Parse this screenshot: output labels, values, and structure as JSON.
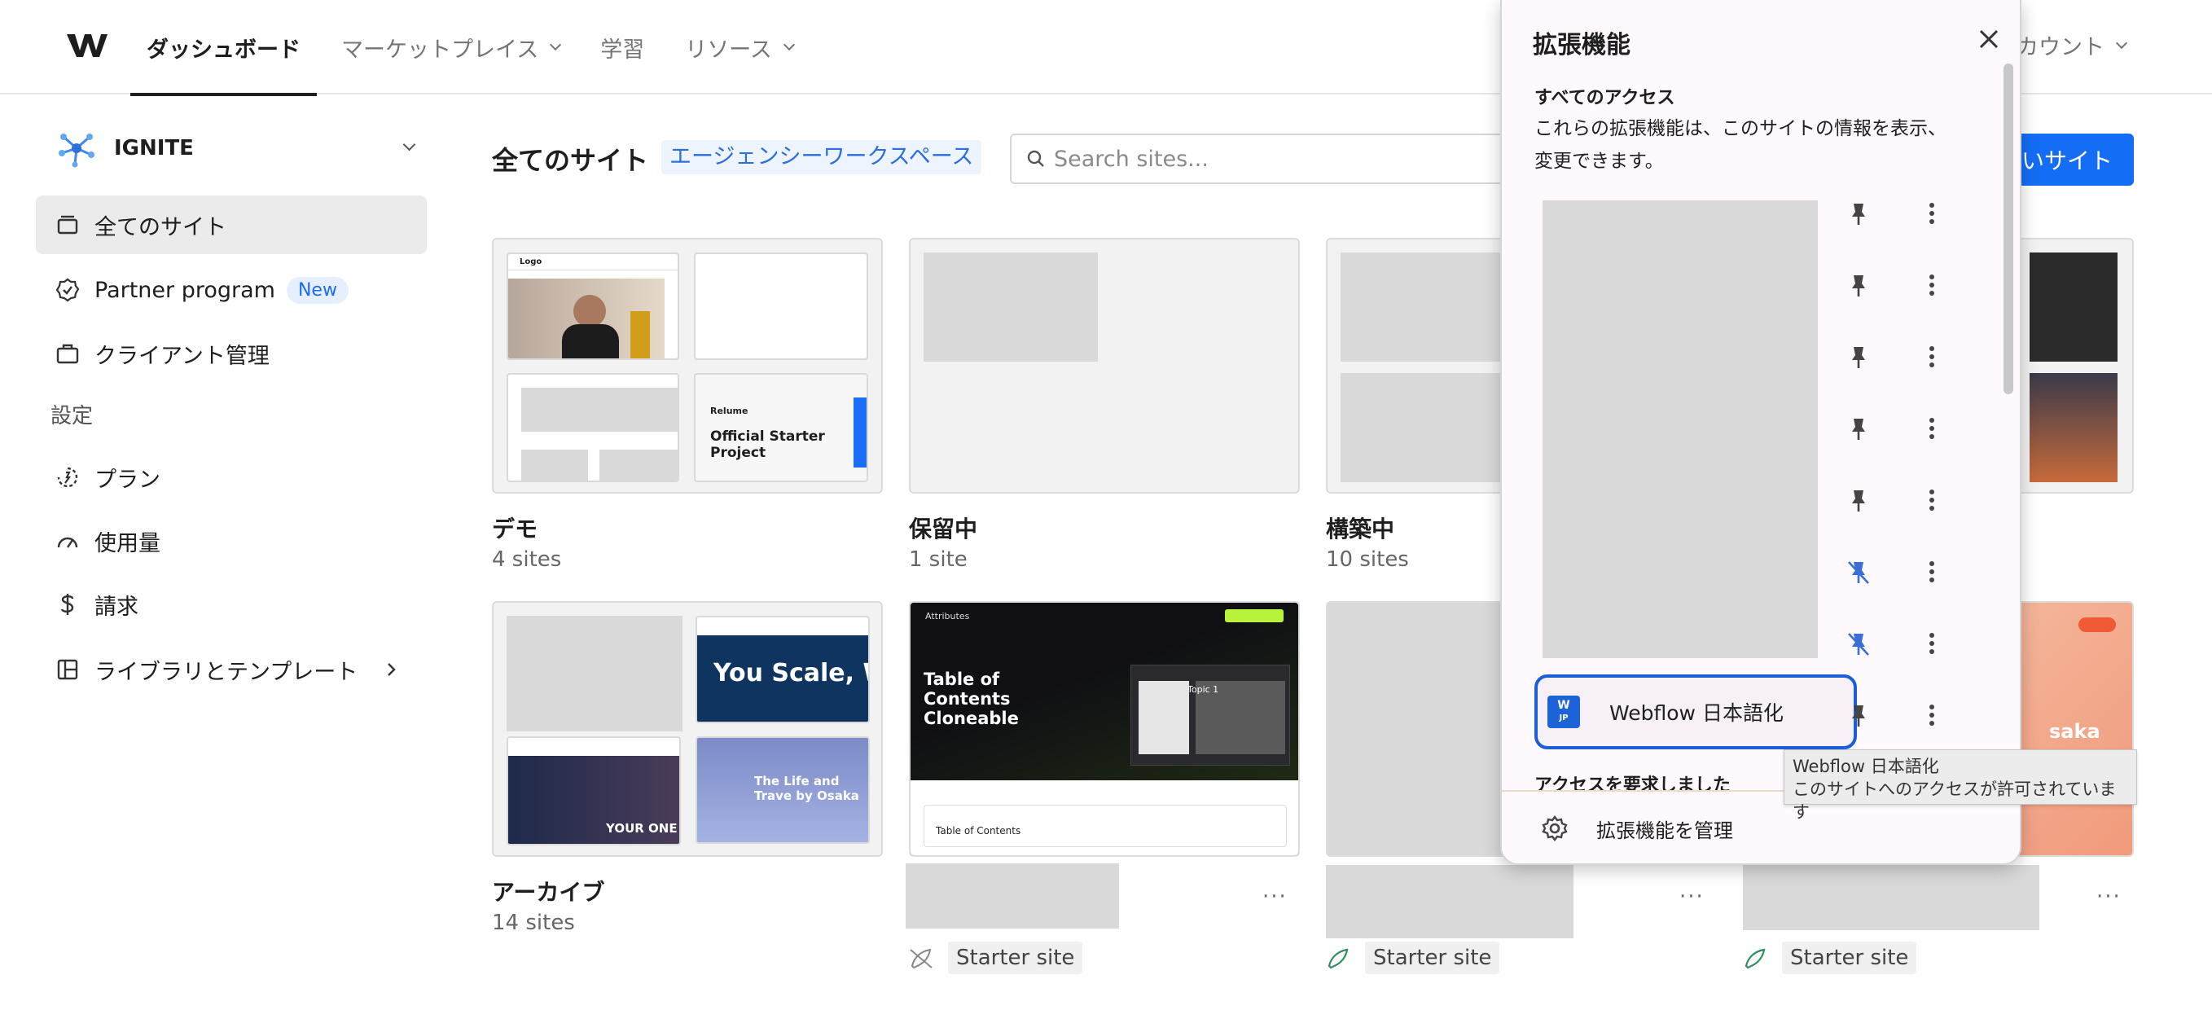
{
  "nav": {
    "items": [
      {
        "label": "ダッシュボード",
        "active": true,
        "dropdown": false
      },
      {
        "label": "マーケットプレイス",
        "active": false,
        "dropdown": true
      },
      {
        "label": "学習",
        "active": false,
        "dropdown": false
      },
      {
        "label": "リソース",
        "active": false,
        "dropdown": true
      }
    ],
    "account": "カウント"
  },
  "sidebar": {
    "workspace": "IGNITE",
    "items": [
      {
        "label": "全てのサイト",
        "icon": "folder-icon"
      },
      {
        "label": "Partner program",
        "icon": "partner-badge-icon",
        "badge": "New"
      },
      {
        "label": "クライアント管理",
        "icon": "briefcase-icon"
      }
    ],
    "settings_label": "設定",
    "settings_items": [
      {
        "label": "プラン",
        "icon": "plan-icon"
      },
      {
        "label": "使用量",
        "icon": "gauge-icon"
      },
      {
        "label": "請求",
        "icon": "dollar-icon"
      },
      {
        "label": "ライブラリとテンプレート",
        "icon": "library-icon"
      }
    ]
  },
  "main": {
    "title": "全てのサイト",
    "workspace_tag": "エージェンシーワークスペース",
    "search_placeholder": "Search sites...",
    "new_site_label": "しいサイト",
    "folders": [
      {
        "name": "デモ",
        "count": "4 sites"
      },
      {
        "name": "保留中",
        "count": "1 site"
      },
      {
        "name": "構築中",
        "count": "10 sites"
      },
      {
        "name": "アーカイブ",
        "count": "14 sites"
      }
    ],
    "thumb_texts": {
      "logo": "Logo",
      "relume": "Relume",
      "official": "Official Starter Project",
      "you_scale": "You Scale, We Sca",
      "life_travel": "The Life and Trave by Osaka",
      "your_one": "YOUR ONE",
      "attributes": "Attributes",
      "toc_title": "Table of Contents Cloneable",
      "toc_bar": "Table of Contents",
      "topic": "Topic 1",
      "osaka": "saka"
    },
    "sites": [
      {
        "status": "Starter site",
        "more": "···"
      },
      {
        "status": "Starter site",
        "more": "···"
      },
      {
        "status": "Starter site",
        "more": "···"
      }
    ]
  },
  "extensions": {
    "title": "拡張機能",
    "section_all": "すべてのアクセス",
    "description": "これらの拡張機能は、このサイトの情報を表示、変更できます。",
    "rows": [
      {
        "pinned": true
      },
      {
        "pinned": true
      },
      {
        "pinned": true
      },
      {
        "pinned": true
      },
      {
        "pinned": true
      },
      {
        "pinned": false
      },
      {
        "pinned": false
      }
    ],
    "webflow": {
      "icon_text": "W",
      "icon_sub": "JP",
      "name": "Webflow 日本語化"
    },
    "section_request": "アクセスを要求しました",
    "manage_label": "拡張機能を管理"
  },
  "tooltip": {
    "line1": "Webflow 日本語化",
    "line2": "このサイトへのアクセスが許可されています"
  },
  "colors": {
    "accent": "#146ef5",
    "selected_border": "#1a5ed8"
  }
}
